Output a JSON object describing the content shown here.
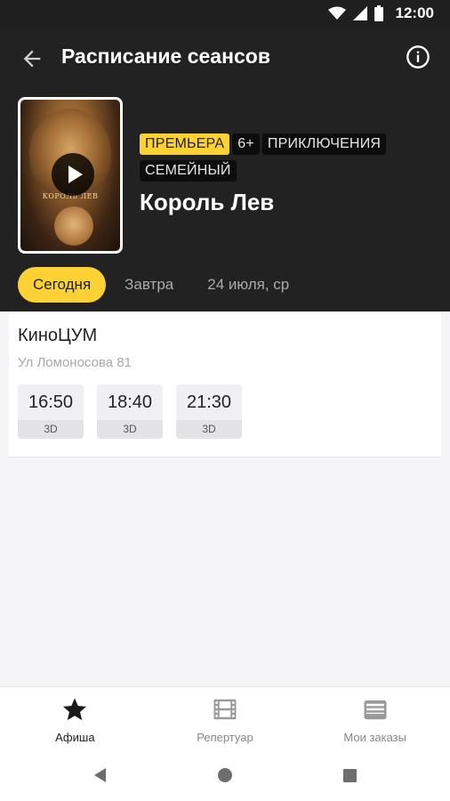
{
  "status": {
    "time": "12:00"
  },
  "header": {
    "title": "Расписание сеансов"
  },
  "movie": {
    "poster_text": "КОРОЛЬ ЛЕВ",
    "tags": [
      {
        "label": "ПРЕМЬЕРА",
        "style": "premiere"
      },
      {
        "label": "6+",
        "style": "dark"
      },
      {
        "label": "ПРИКЛЮЧЕНИЯ",
        "style": "dark"
      },
      {
        "label": "СЕМЕЙНЫЙ",
        "style": "dark"
      }
    ],
    "title": "Король Лев"
  },
  "days": [
    {
      "label": "Сегодня",
      "active": true
    },
    {
      "label": "Завтра",
      "active": false
    },
    {
      "label": "24 июля, ср",
      "active": false
    }
  ],
  "cinema": {
    "name": "КиноЦУМ",
    "address": "Ул Ломоносова 81",
    "sessions": [
      {
        "time": "16:50",
        "format": "3D"
      },
      {
        "time": "18:40",
        "format": "3D"
      },
      {
        "time": "21:30",
        "format": "3D"
      }
    ]
  },
  "tabs": [
    {
      "label": "Афиша",
      "icon": "star-icon",
      "active": true
    },
    {
      "label": "Репертуар",
      "icon": "film-icon",
      "active": false
    },
    {
      "label": "Мои заказы",
      "icon": "wallet-icon",
      "active": false
    }
  ],
  "colors": {
    "accent": "#fcd133",
    "header_bg": "#222222"
  }
}
